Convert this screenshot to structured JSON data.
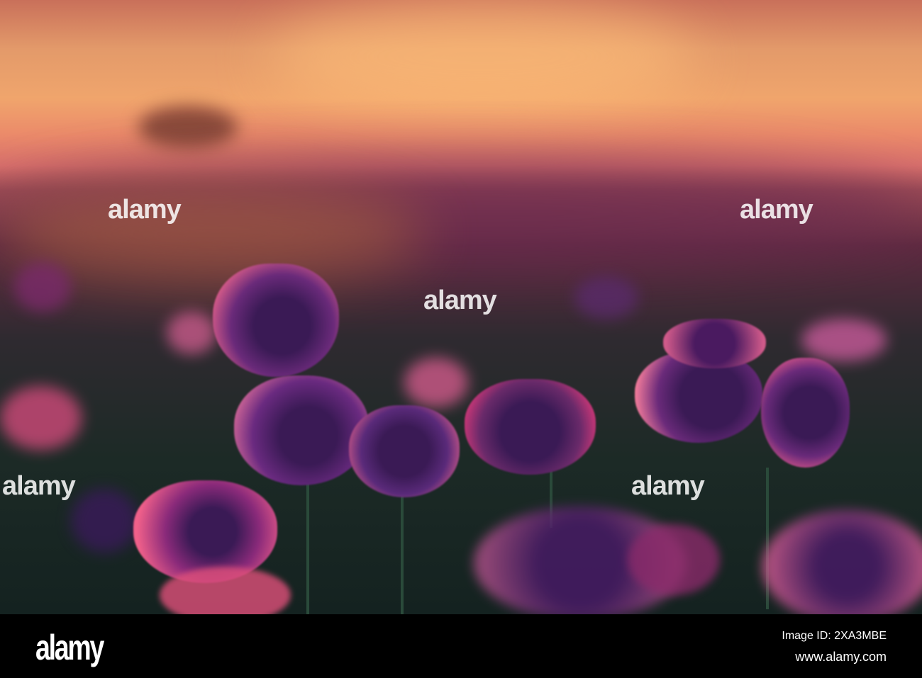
{
  "photo": {
    "subject": "poppy field at sunset",
    "accent": "#8a2a7a",
    "sky": "#f0a56c"
  },
  "watermark": {
    "text": "alamy"
  },
  "footer": {
    "logo": "alamy",
    "image_id": "Image ID: 2XA3MBE",
    "url": "www.alamy.com"
  }
}
